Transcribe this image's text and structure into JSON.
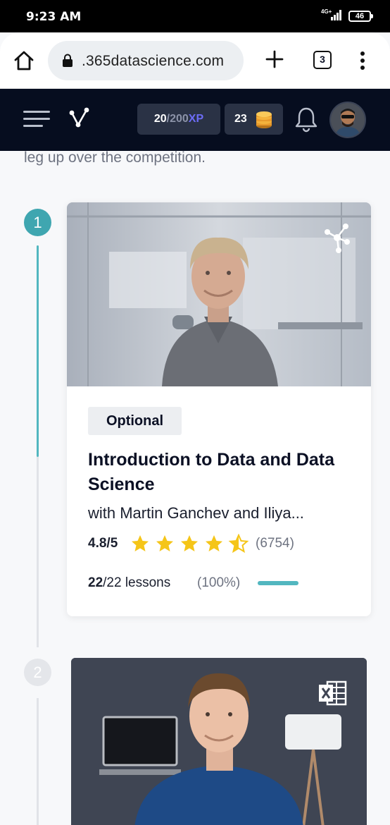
{
  "status_bar": {
    "time": "9:23 AM",
    "network": "4G+",
    "battery": "46"
  },
  "browser": {
    "url": ".365datascience.com",
    "tab_count": "3",
    "icons": [
      "home-icon",
      "lock-icon",
      "plus-icon",
      "tabs-icon",
      "more-vert-icon"
    ]
  },
  "header": {
    "xp_current": "20",
    "xp_total": "/200",
    "xp_unit": "XP",
    "coins": "23",
    "icons": [
      "hamburger-icon",
      "logo-icon",
      "coins-icon",
      "bell-icon",
      "avatar"
    ]
  },
  "content": {
    "intro_text": "leg up over the competition.",
    "steps": [
      {
        "number": "1",
        "tag": "Optional",
        "title": "Introduction to Data and Data Science",
        "instructors": "with Martin Ganchev and Iliya...",
        "rating": "4.8/5",
        "rating_stars": 4.5,
        "rating_count": "(6754)",
        "lessons_done": "22",
        "lessons_total": "/22 lessons",
        "progress_pct_label": "(100%)",
        "progress": 1.0
      },
      {
        "number": "2"
      }
    ]
  },
  "colors": {
    "accent": "#3fa6b0",
    "header_bg": "#060d1f",
    "star": "#f5c518",
    "xp": "#6c6cf5"
  }
}
